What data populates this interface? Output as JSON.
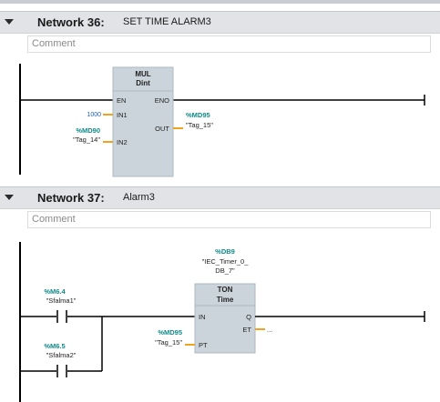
{
  "networks": [
    {
      "label": "Network 36:",
      "title": "SET TIME ALARM3",
      "comment_placeholder": "Comment",
      "block": {
        "name_line1": "MUL",
        "name_line2": "Dint",
        "pin_en": "EN",
        "pin_eno": "ENO",
        "pin_in1": "IN1",
        "pin_in2": "IN2",
        "pin_out": "OUT"
      },
      "in1_value": "1000",
      "in2_address": "%MD90",
      "in2_tag": "\"Tag_14\"",
      "out_address": "%MD95",
      "out_tag": "\"Tag_15\""
    },
    {
      "label": "Network 37:",
      "title": "Alarm3",
      "comment_placeholder": "Comment",
      "instance_address": "%DB9",
      "instance_name_line1": "\"IEC_Timer_0_",
      "instance_name_line2": "DB_7\"",
      "block": {
        "name_line1": "TON",
        "name_line2": "Time",
        "pin_in": "IN",
        "pin_pt": "PT",
        "pin_q": "Q",
        "pin_et": "ET"
      },
      "contact1_address": "%M6.4",
      "contact1_tag": "\"Sfalma1\"",
      "contact2_address": "%M6.5",
      "contact2_tag": "\"Sfalma2\"",
      "pt_address": "%MD95",
      "pt_tag": "\"Tag_15\"",
      "et_value": "..."
    }
  ],
  "colors": {
    "address_teal": "#0f8a8a",
    "constant_blue": "#1f5fbf",
    "pin_orange": "#f0a31e",
    "block_fill": "#cbd4db",
    "header_bg": "#e1e3e6"
  }
}
